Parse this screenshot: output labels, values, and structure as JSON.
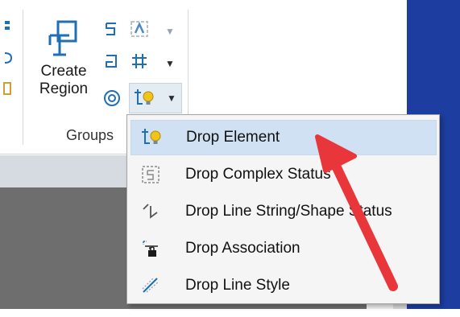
{
  "ribbon": {
    "create_region_label_line1": "Create",
    "create_region_label_line2": "Region",
    "group_label": "Groups"
  },
  "menu": {
    "items": [
      {
        "label": "Drop Element",
        "icon": "drop-element-icon",
        "highlighted": true
      },
      {
        "label": "Drop Complex Status",
        "icon": "drop-complex-status-icon"
      },
      {
        "label": "Drop Line String/Shape Status",
        "icon": "drop-line-string-icon"
      },
      {
        "label": "Drop Association",
        "icon": "drop-association-icon"
      },
      {
        "label": "Drop Line Style",
        "icon": "drop-line-style-icon"
      }
    ]
  },
  "colors": {
    "accent_blue": "#1d3ea0",
    "icon_blue": "#1f6fb5",
    "bulb_yellow": "#f2c318",
    "highlight": "#cfe1f3",
    "arrow_red": "#e8363b"
  }
}
